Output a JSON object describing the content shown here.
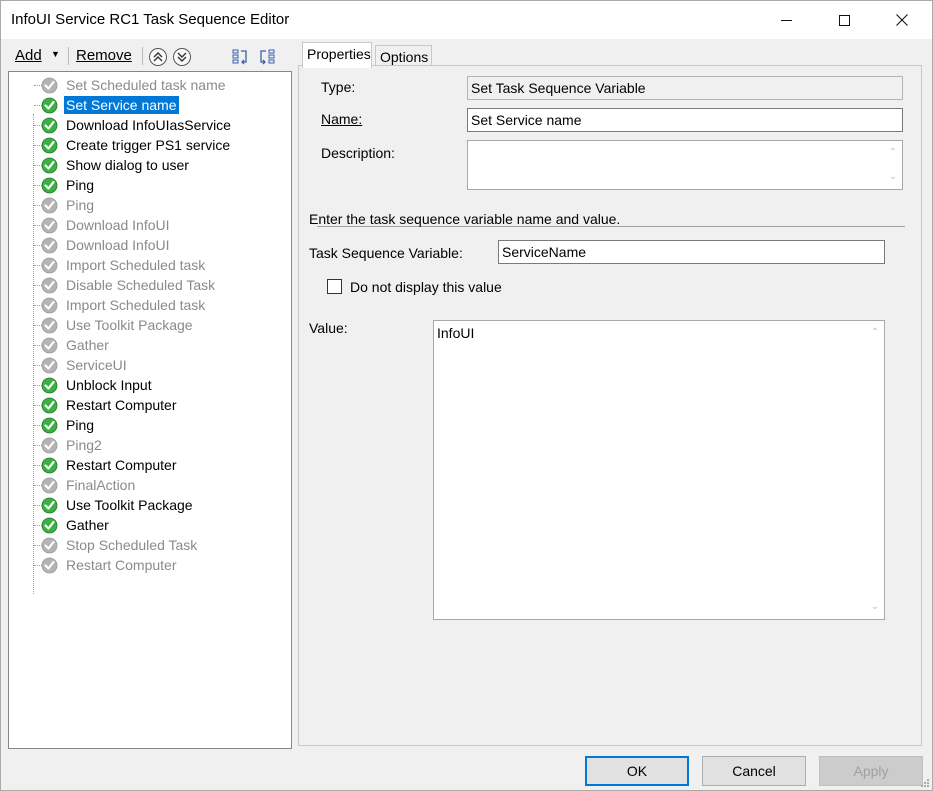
{
  "window": {
    "title": "InfoUI Service RC1 Task Sequence Editor"
  },
  "toolbar": {
    "add_label": "Add",
    "remove_label": "Remove"
  },
  "tree": {
    "items": [
      {
        "label": "Set Scheduled task name",
        "enabled": false
      },
      {
        "label": "Set Service name",
        "enabled": true,
        "selected": true
      },
      {
        "label": "Download InfoUIasService",
        "enabled": true
      },
      {
        "label": "Create trigger PS1 service",
        "enabled": true
      },
      {
        "label": "Show dialog to user",
        "enabled": true
      },
      {
        "label": "Ping",
        "enabled": true
      },
      {
        "label": "Ping",
        "enabled": false
      },
      {
        "label": "Download InfoUI",
        "enabled": false
      },
      {
        "label": "Download InfoUI",
        "enabled": false
      },
      {
        "label": "Import Scheduled task",
        "enabled": false
      },
      {
        "label": "Disable Scheduled Task",
        "enabled": false
      },
      {
        "label": "Import Scheduled task",
        "enabled": false
      },
      {
        "label": "Use Toolkit Package",
        "enabled": false
      },
      {
        "label": "Gather",
        "enabled": false
      },
      {
        "label": "ServiceUI",
        "enabled": false
      },
      {
        "label": "Unblock Input",
        "enabled": true
      },
      {
        "label": "Restart Computer",
        "enabled": true
      },
      {
        "label": "Ping",
        "enabled": true
      },
      {
        "label": "Ping2",
        "enabled": false
      },
      {
        "label": "Restart Computer",
        "enabled": true
      },
      {
        "label": "FinalAction",
        "enabled": false
      },
      {
        "label": "Use Toolkit Package",
        "enabled": true
      },
      {
        "label": "Gather",
        "enabled": true
      },
      {
        "label": "Stop Scheduled Task",
        "enabled": false
      },
      {
        "label": "Restart Computer",
        "enabled": false
      }
    ]
  },
  "tabs": {
    "properties": "Properties",
    "options": "Options"
  },
  "properties": {
    "type_label": "Type:",
    "type_value": "Set Task Sequence Variable",
    "name_label": "Name:",
    "name_value": "Set Service name",
    "description_label": "Description:",
    "description_value": "",
    "instruction": "Enter the task sequence variable name and value.",
    "variable_label": "Task Sequence Variable:",
    "variable_value": "ServiceName",
    "hide_value_label": "Do not display this value",
    "hide_value_checked": false,
    "value_label": "Value:",
    "value_value": "InfoUI"
  },
  "buttons": {
    "ok": "OK",
    "cancel": "Cancel",
    "apply": "Apply"
  },
  "colors": {
    "selection": "#0078d7",
    "enabled_check": "#3cb043",
    "disabled_icon": "#b4b4b4"
  }
}
